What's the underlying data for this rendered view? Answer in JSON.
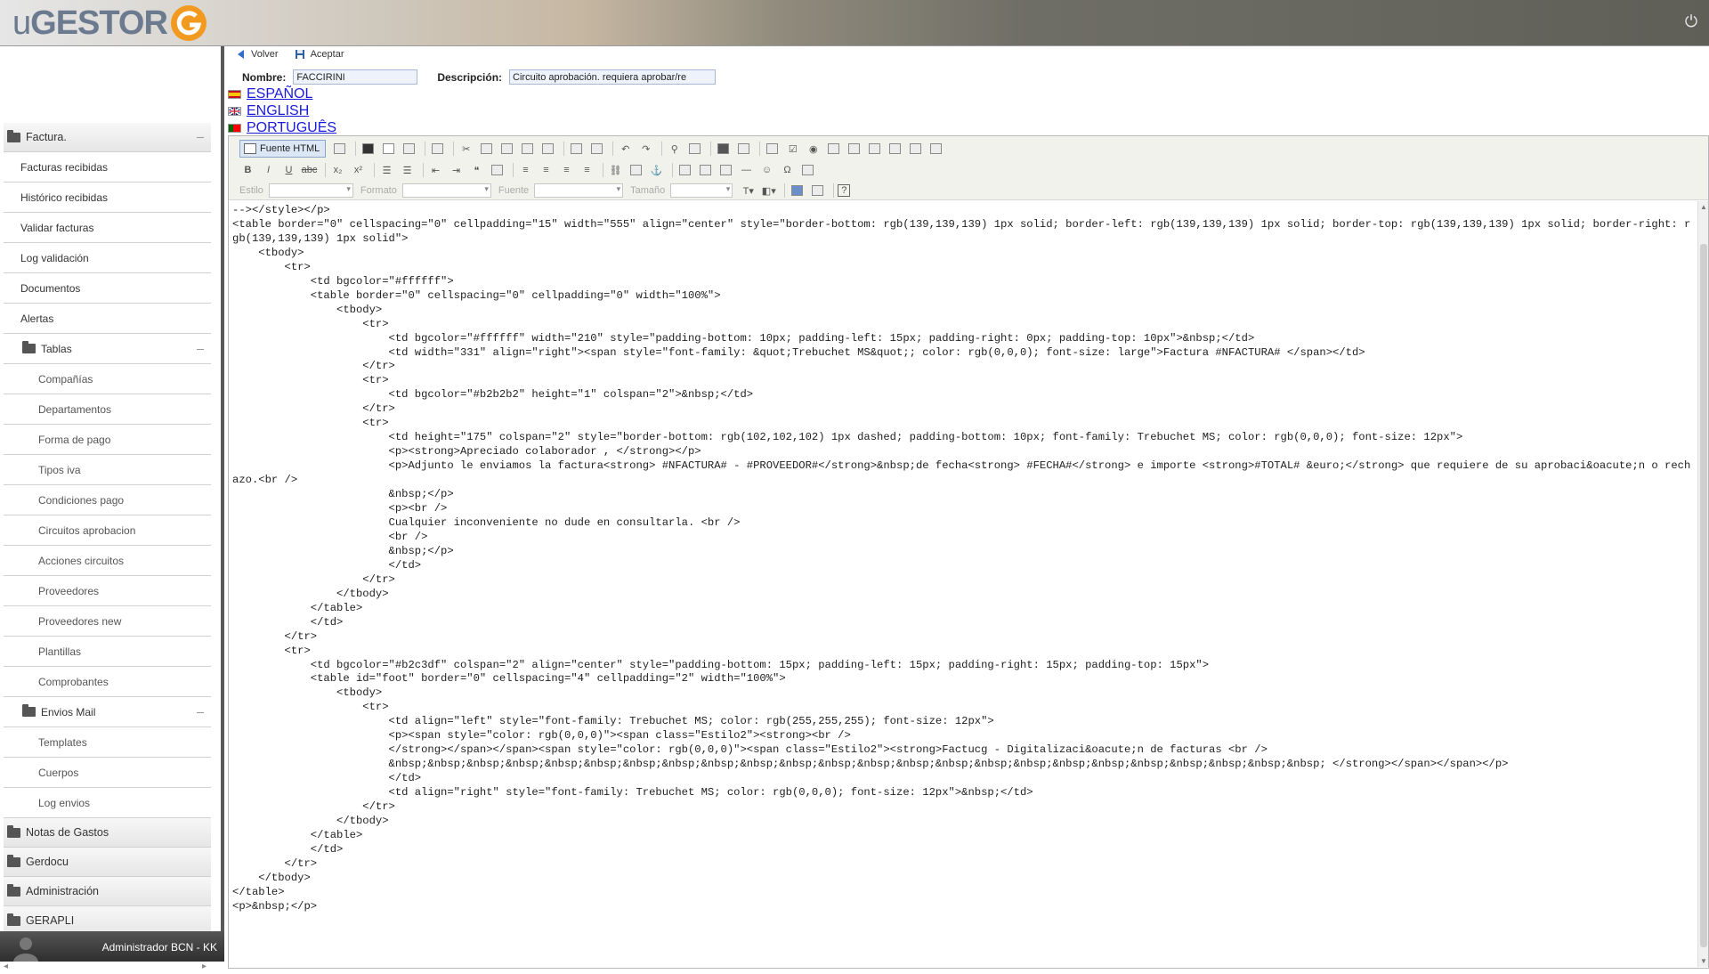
{
  "app": {
    "logo": "GESTOR",
    "logo_prefix": "u"
  },
  "actions": {
    "back": "Volver",
    "accept": "Aceptar"
  },
  "form": {
    "name_label": "Nombre:",
    "name_value": "FACCIRINI",
    "desc_label": "Descripción:",
    "desc_value": "Circuito aprobación. requiera aprobar/re"
  },
  "languages": [
    {
      "label": "ESPAÑOL"
    },
    {
      "label": "ENGLISH"
    },
    {
      "label": "PORTUGUÊS"
    }
  ],
  "editor": {
    "source_button": "Fuente HTML",
    "style_label": "Estilo",
    "format_label": "Formato",
    "font_label": "Fuente",
    "size_label": "Tamaño",
    "code": "--></style></p>\n<table border=\"0\" cellspacing=\"0\" cellpadding=\"15\" width=\"555\" align=\"center\" style=\"border-bottom: rgb(139,139,139) 1px solid; border-left: rgb(139,139,139) 1px solid; border-top: rgb(139,139,139) 1px solid; border-right: rgb(139,139,139) 1px solid\">\n    <tbody>\n        <tr>\n            <td bgcolor=\"#ffffff\">\n            <table border=\"0\" cellspacing=\"0\" cellpadding=\"0\" width=\"100%\">\n                <tbody>\n                    <tr>\n                        <td bgcolor=\"#ffffff\" width=\"210\" style=\"padding-bottom: 10px; padding-left: 15px; padding-right: 0px; padding-top: 10px\">&nbsp;</td>\n                        <td width=\"331\" align=\"right\"><span style=\"font-family: &quot;Trebuchet MS&quot;; color: rgb(0,0,0); font-size: large\">Factura #NFACTURA# </span></td>\n                    </tr>\n                    <tr>\n                        <td bgcolor=\"#b2b2b2\" height=\"1\" colspan=\"2\">&nbsp;</td>\n                    </tr>\n                    <tr>\n                        <td height=\"175\" colspan=\"2\" style=\"border-bottom: rgb(102,102,102) 1px dashed; padding-bottom: 10px; font-family: Trebuchet MS; color: rgb(0,0,0); font-size: 12px\">\n                        <p><strong>Apreciado colaborador , </strong></p>\n                        <p>Adjunto le enviamos la factura<strong> #NFACTURA# - #PROVEEDOR#</strong>&nbsp;de fecha<strong> #FECHA#</strong> e importe <strong>#TOTAL# &euro;</strong> que requiere de su aprobaci&oacute;n o rechazo.<br />\n                        &nbsp;</p>\n                        <p><br />\n                        Cualquier inconveniente no dude en consultarla. <br />\n                        <br />\n                        &nbsp;</p>\n                        </td>\n                    </tr>\n                </tbody>\n            </table>\n            </td>\n        </tr>\n        <tr>\n            <td bgcolor=\"#b2c3df\" colspan=\"2\" align=\"center\" style=\"padding-bottom: 15px; padding-left: 15px; padding-right: 15px; padding-top: 15px\">\n            <table id=\"foot\" border=\"0\" cellspacing=\"4\" cellpadding=\"2\" width=\"100%\">\n                <tbody>\n                    <tr>\n                        <td align=\"left\" style=\"font-family: Trebuchet MS; color: rgb(255,255,255); font-size: 12px\">\n                        <p><span style=\"color: rgb(0,0,0)\"><span class=\"Estilo2\"><strong><br />\n                        </strong></span></span><span style=\"color: rgb(0,0,0)\"><span class=\"Estilo2\"><strong>Factucg - Digitalizaci&oacute;n de facturas <br />\n                        &nbsp;&nbsp;&nbsp;&nbsp;&nbsp;&nbsp;&nbsp;&nbsp;&nbsp;&nbsp;&nbsp;&nbsp;&nbsp;&nbsp;&nbsp;&nbsp;&nbsp;&nbsp;&nbsp;&nbsp;&nbsp;&nbsp;&nbsp;&nbsp; </strong></span></span></p>\n                        </td>\n                        <td align=\"right\" style=\"font-family: Trebuchet MS; color: rgb(0,0,0); font-size: 12px\">&nbsp;</td>\n                    </tr>\n                </tbody>\n            </table>\n            </td>\n        </tr>\n    </tbody>\n</table>\n<p>&nbsp;</p>"
  },
  "sidebar": [
    {
      "label": "Factura.",
      "kind": "cat",
      "collapse": true
    },
    {
      "label": "Facturas recibidas",
      "kind": "l1"
    },
    {
      "label": "Histórico recibidas",
      "kind": "l1"
    },
    {
      "label": "Validar facturas",
      "kind": "l1"
    },
    {
      "label": "Log validación",
      "kind": "l1"
    },
    {
      "label": "Documentos",
      "kind": "l1"
    },
    {
      "label": "Alertas",
      "kind": "l1"
    },
    {
      "label": "Tablas",
      "kind": "sub",
      "collapse": true
    },
    {
      "label": "Compañías",
      "kind": "l2"
    },
    {
      "label": "Departamentos",
      "kind": "l2"
    },
    {
      "label": "Forma de pago",
      "kind": "l2"
    },
    {
      "label": "Tipos iva",
      "kind": "l2"
    },
    {
      "label": "Condiciones pago",
      "kind": "l2"
    },
    {
      "label": "Circuitos aprobacion",
      "kind": "l2"
    },
    {
      "label": "Acciones circuitos",
      "kind": "l2"
    },
    {
      "label": "Proveedores",
      "kind": "l2"
    },
    {
      "label": "Proveedores new",
      "kind": "l2"
    },
    {
      "label": "Plantillas",
      "kind": "l2"
    },
    {
      "label": "Comprobantes",
      "kind": "l2"
    },
    {
      "label": "Envios Mail",
      "kind": "sub",
      "collapse": true
    },
    {
      "label": "Templates",
      "kind": "l2"
    },
    {
      "label": "Cuerpos",
      "kind": "l2"
    },
    {
      "label": "Log envios",
      "kind": "l2"
    },
    {
      "label": "Notas de Gastos",
      "kind": "cat"
    },
    {
      "label": "Gerdocu",
      "kind": "cat"
    },
    {
      "label": "Administración",
      "kind": "cat"
    },
    {
      "label": "GERAPLI",
      "kind": "cat"
    }
  ],
  "user": {
    "name": "Administrador BCN - KK"
  },
  "colors": {
    "link": "#1a1adb",
    "logo_orange": "#f29a1f",
    "logo_text": "#6b7a8e"
  },
  "icons": [
    "folder-icon",
    "back-arrow-icon",
    "save-icon",
    "power-icon",
    "flag-icon",
    "source-html-icon"
  ]
}
